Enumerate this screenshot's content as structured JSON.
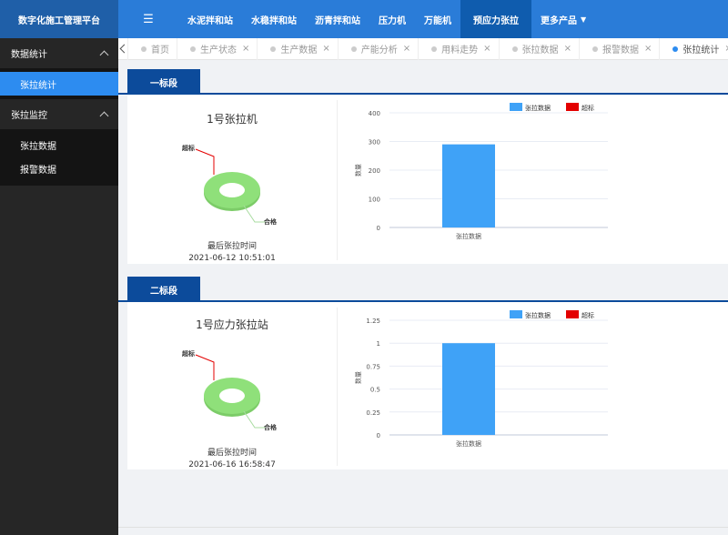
{
  "app": {
    "brand": "数字化施工管理平台"
  },
  "topnav": {
    "menu_icon": "list-icon",
    "items": [
      {
        "label": "水泥拌和站"
      },
      {
        "label": "水稳拌和站"
      },
      {
        "label": "沥青拌和站"
      },
      {
        "label": "压力机"
      },
      {
        "label": "万能机"
      },
      {
        "label": "预应力张拉",
        "active": true
      },
      {
        "label": "更多产品",
        "dropdown": true
      }
    ]
  },
  "sidebar": {
    "groups": [
      {
        "label": "数据统计",
        "expanded": true,
        "items": [
          {
            "label": "张拉统计",
            "active": true
          }
        ]
      },
      {
        "label": "张拉监控",
        "expanded": true,
        "items": [
          {
            "label": "张拉数据"
          },
          {
            "label": "报警数据"
          }
        ]
      }
    ]
  },
  "tabs": [
    {
      "label": "首页"
    },
    {
      "label": "生产状态"
    },
    {
      "label": "生产数据"
    },
    {
      "label": "产能分析"
    },
    {
      "label": "用料走势"
    },
    {
      "label": "张拉数据"
    },
    {
      "label": "报警数据"
    },
    {
      "label": "张拉统计",
      "active": true
    }
  ],
  "sections": [
    {
      "label": "一标段",
      "machine": "1号张拉机",
      "donut_labels": {
        "over": "超标",
        "ok": "合格"
      },
      "last_time_label": "最后张拉时间",
      "last_time": "2021-06-12 10:51:01",
      "chart_data": {
        "type": "bar",
        "categories": [
          "张拉数据"
        ],
        "series": [
          {
            "name": "张拉数据",
            "values": [
              290
            ],
            "color": "#3fa2f7"
          },
          {
            "name": "超标",
            "values": [
              0
            ],
            "color": "#e30000"
          }
        ],
        "ylabel": "数量",
        "ylim": [
          0,
          400
        ],
        "yticks": [
          "0",
          "100",
          "200",
          "300",
          "400"
        ],
        "legend": "top-right"
      }
    },
    {
      "label": "二标段",
      "machine": "1号应力张拉站",
      "donut_labels": {
        "over": "超标",
        "ok": "合格"
      },
      "last_time_label": "最后张拉时间",
      "last_time": "2021-06-16 16:58:47",
      "chart_data": {
        "type": "bar",
        "categories": [
          "张拉数据"
        ],
        "series": [
          {
            "name": "张拉数据",
            "values": [
              1
            ],
            "color": "#3fa2f7"
          },
          {
            "name": "超标",
            "values": [
              0
            ],
            "color": "#e30000"
          }
        ],
        "ylabel": "数量",
        "ylim": [
          0,
          1.25
        ],
        "yticks": [
          "0",
          "0.25",
          "0.5",
          "0.75",
          "1",
          "1.25"
        ],
        "legend": "top-right"
      }
    }
  ],
  "colors": {
    "brand_bg": "#1f5fa8",
    "nav_bg": "#2a7cd8",
    "nav_active": "#0f5cae",
    "section_tab": "#0c4b9b",
    "donut": "#8fe07a",
    "over_line": "#e30000",
    "ok_line": "#a8dca0"
  }
}
